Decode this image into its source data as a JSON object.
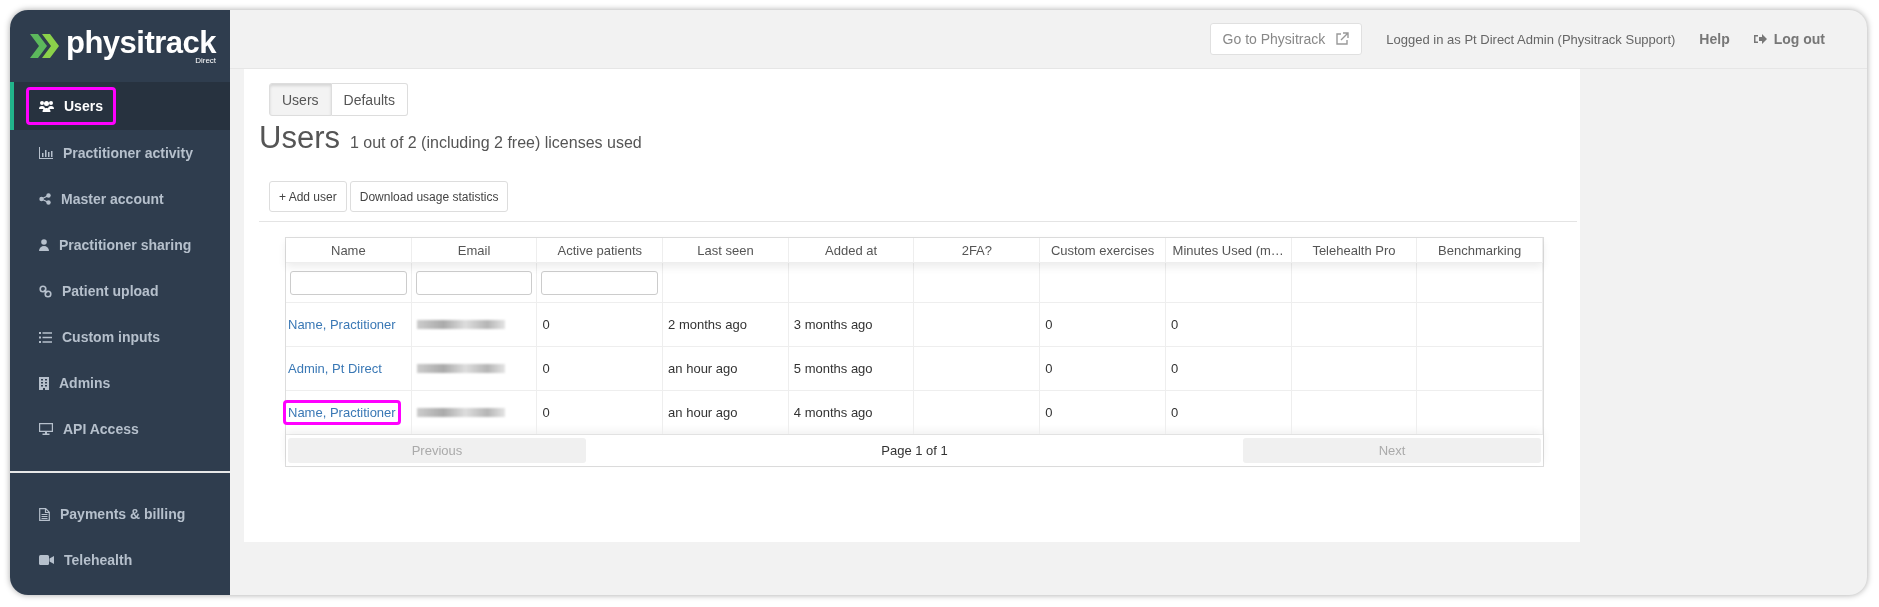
{
  "sidebar": {
    "logo": {
      "name": "physitrack",
      "subtitle": "Direct"
    },
    "items": [
      {
        "label": "Users",
        "selected": true,
        "highlighted": true
      },
      {
        "label": "Practitioner activity",
        "selected": false,
        "highlighted": false
      },
      {
        "label": "Master account",
        "selected": false,
        "highlighted": false
      },
      {
        "label": "Practitioner sharing",
        "selected": false,
        "highlighted": false
      },
      {
        "label": "Patient upload",
        "selected": false,
        "highlighted": false
      },
      {
        "label": "Custom inputs",
        "selected": false,
        "highlighted": false
      },
      {
        "label": "Admins",
        "selected": false,
        "highlighted": false
      },
      {
        "label": "API Access",
        "selected": false,
        "highlighted": false
      }
    ],
    "bottom_items": [
      {
        "label": "Payments & billing",
        "selected": false
      },
      {
        "label": "Telehealth",
        "selected": false
      }
    ]
  },
  "top_bar": {
    "external_button": "Go to Physitrack",
    "user_text": "Logged in as Pt Direct Admin (Physitrack Support)",
    "help": "Help",
    "logout": "Log out"
  },
  "tabs": [
    {
      "label": "Users",
      "selected": true
    },
    {
      "label": "Defaults",
      "selected": false
    }
  ],
  "heading": {
    "title": "Users",
    "subtitle": "1 out of 2 (including 2 free) licenses used"
  },
  "actions": [
    "+ Add user",
    "Download usage statistics"
  ],
  "table": {
    "columns": [
      {
        "label": "Name",
        "filter": true
      },
      {
        "label": "Email",
        "filter": true
      },
      {
        "label": "Active patients",
        "filter": true
      },
      {
        "label": "Last seen"
      },
      {
        "label": "Added at"
      },
      {
        "label": "2FA?"
      },
      {
        "label": "Custom exercises"
      },
      {
        "label": "Minutes Used (m…"
      },
      {
        "label": "Telehealth Pro"
      },
      {
        "label": "Benchmarking"
      }
    ],
    "rows": [
      {
        "name": "Name, Practitioner",
        "email_hidden": true,
        "active_patients": "0",
        "last_seen": "2 months ago",
        "added_at": "3 months ago",
        "custom_exercises": "0",
        "minutes_used": "0",
        "highlighted": false
      },
      {
        "name": "Admin, Pt Direct",
        "email_hidden": true,
        "active_patients": "0",
        "last_seen": "an hour ago",
        "added_at": "5 months ago",
        "custom_exercises": "0",
        "minutes_used": "0",
        "highlighted": false
      },
      {
        "name": "Name, Practitioner",
        "email_hidden": true,
        "active_patients": "0",
        "last_seen": "an hour ago",
        "added_at": "4 months ago",
        "custom_exercises": "0",
        "minutes_used": "0",
        "highlighted": true
      }
    ],
    "pagination": {
      "previous": {
        "label": "Previous",
        "disabled": true
      },
      "page_info": "Page 1 of 1",
      "next": {
        "label": "Next",
        "disabled": true
      }
    }
  }
}
